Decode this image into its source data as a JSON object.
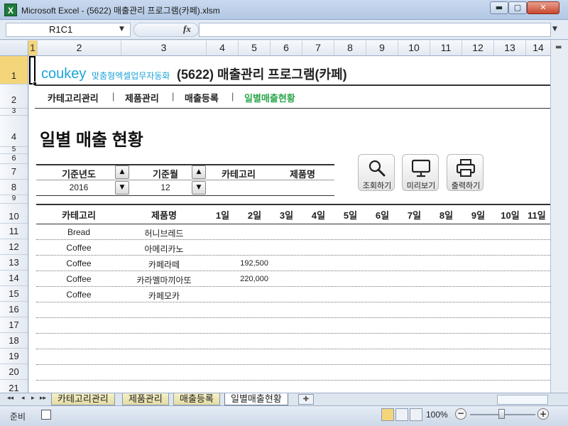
{
  "window": {
    "title": "Microsoft Excel - (5622) 매출관리 프로그램(카페).xlsm",
    "app_icon": "X",
    "min_label": "▬",
    "max_label": "▢",
    "close_label": "✕"
  },
  "formula_bar": {
    "name_box": "R1C1",
    "fx_label": "fx",
    "formula": ""
  },
  "columns": [
    "1",
    "2",
    "3",
    "4",
    "5",
    "6",
    "7",
    "8",
    "9",
    "10",
    "11",
    "12",
    "13",
    "14"
  ],
  "rows": [
    "1",
    "2",
    "3",
    "4",
    "5",
    "6",
    "7",
    "8",
    "9",
    "10",
    "11",
    "12",
    "13",
    "14",
    "15",
    "16",
    "17",
    "18",
    "19",
    "20",
    "21"
  ],
  "brand": {
    "logo": "coukey",
    "tagline": "맞춤형엑셀업무자동화",
    "app_title": "(5622) 매출관리 프로그램(카페)"
  },
  "nav": [
    {
      "label": "카테고리관리"
    },
    {
      "label": "제품관리"
    },
    {
      "label": "매출등록"
    },
    {
      "label": "일별매출현황"
    }
  ],
  "nav_separator": "|",
  "page_title": "일별 매출 현황",
  "filter": {
    "year_label": "기준년도",
    "year_value": "2016",
    "month_label": "기준월",
    "month_value": "12",
    "category_label": "카테고리",
    "product_label": "제품명",
    "spin_up": "▲",
    "spin_down": "▼"
  },
  "actions": [
    {
      "label": "조회하기",
      "icon": "search-icon"
    },
    {
      "label": "미리보기",
      "icon": "monitor-icon"
    },
    {
      "label": "출력하기",
      "icon": "printer-icon"
    }
  ],
  "table": {
    "headers": [
      "카테고리",
      "제품명",
      "1일",
      "2일",
      "3일",
      "4일",
      "5일",
      "6일",
      "7일",
      "8일",
      "9일",
      "10일",
      "11일"
    ],
    "rows": [
      {
        "category": "Bread",
        "product": "허니브레드",
        "day2": ""
      },
      {
        "category": "Coffee",
        "product": "아메리카노",
        "day2": ""
      },
      {
        "category": "Coffee",
        "product": "카페라떼",
        "day2": "192,500"
      },
      {
        "category": "Coffee",
        "product": "카라멜마끼아또",
        "day2": "220,000"
      },
      {
        "category": "Coffee",
        "product": "카페모카",
        "day2": ""
      },
      {
        "category": "",
        "product": "",
        "day2": ""
      },
      {
        "category": "",
        "product": "",
        "day2": ""
      },
      {
        "category": "",
        "product": "",
        "day2": ""
      },
      {
        "category": "",
        "product": "",
        "day2": ""
      },
      {
        "category": "",
        "product": "",
        "day2": ""
      },
      {
        "category": "",
        "product": "",
        "day2": ""
      }
    ]
  },
  "sheet_tabs": [
    {
      "label": "카테고리관리"
    },
    {
      "label": "제품관리"
    },
    {
      "label": "매출등록"
    },
    {
      "label": "일별매출현황"
    }
  ],
  "tab_nav": [
    "◂◂",
    "◂",
    "▸",
    "▸▸"
  ],
  "status": {
    "ready": "준비",
    "zoom": "100%",
    "zoom_minus": "−",
    "zoom_plus": "+"
  },
  "colors": {
    "brand": "#1aa3d8",
    "active_nav": "#2aa64a",
    "selection": "#f5d57a"
  }
}
